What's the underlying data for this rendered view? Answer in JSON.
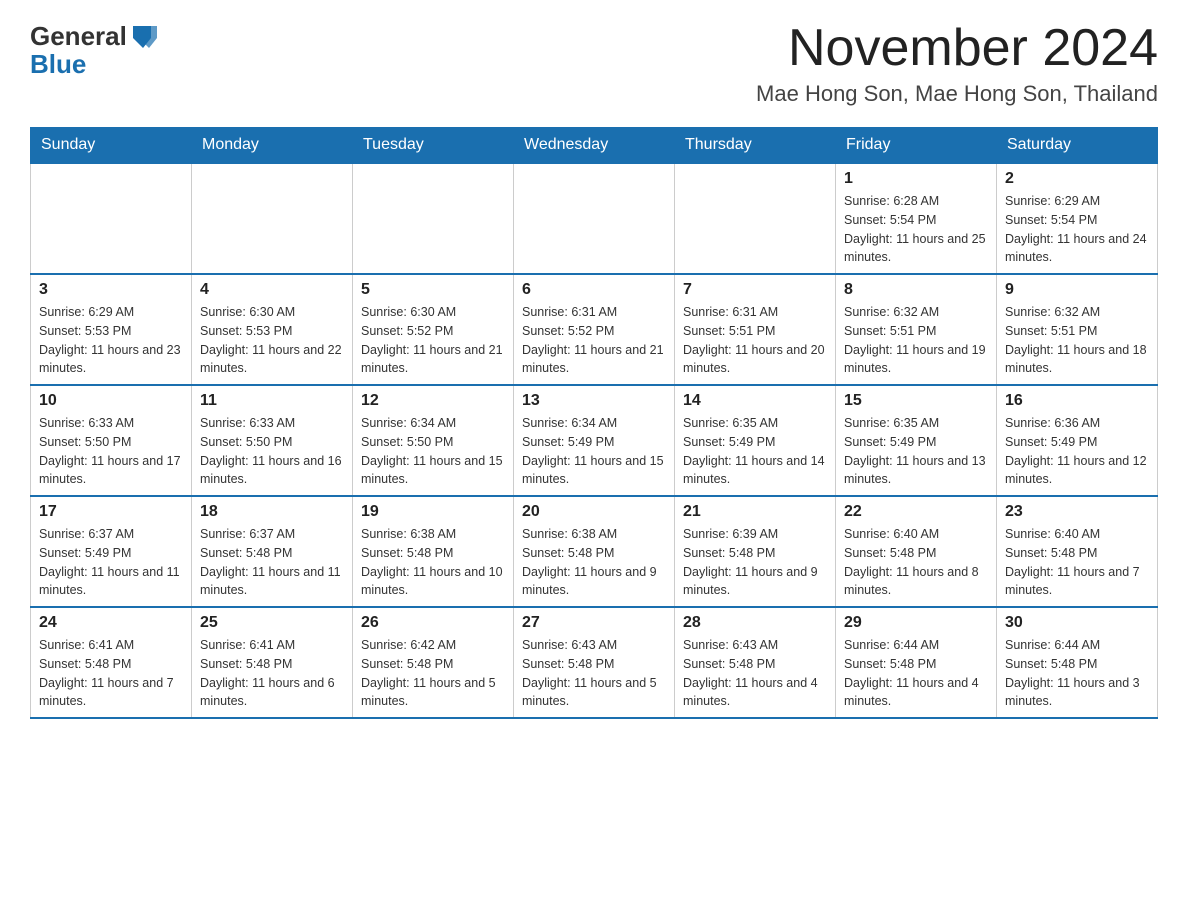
{
  "header": {
    "logo_general": "General",
    "logo_blue": "Blue",
    "month_title": "November 2024",
    "location": "Mae Hong Son, Mae Hong Son, Thailand"
  },
  "weekdays": [
    "Sunday",
    "Monday",
    "Tuesday",
    "Wednesday",
    "Thursday",
    "Friday",
    "Saturday"
  ],
  "weeks": [
    [
      {
        "day": "",
        "sunrise": "",
        "sunset": "",
        "daylight": ""
      },
      {
        "day": "",
        "sunrise": "",
        "sunset": "",
        "daylight": ""
      },
      {
        "day": "",
        "sunrise": "",
        "sunset": "",
        "daylight": ""
      },
      {
        "day": "",
        "sunrise": "",
        "sunset": "",
        "daylight": ""
      },
      {
        "day": "",
        "sunrise": "",
        "sunset": "",
        "daylight": ""
      },
      {
        "day": "1",
        "sunrise": "Sunrise: 6:28 AM",
        "sunset": "Sunset: 5:54 PM",
        "daylight": "Daylight: 11 hours and 25 minutes."
      },
      {
        "day": "2",
        "sunrise": "Sunrise: 6:29 AM",
        "sunset": "Sunset: 5:54 PM",
        "daylight": "Daylight: 11 hours and 24 minutes."
      }
    ],
    [
      {
        "day": "3",
        "sunrise": "Sunrise: 6:29 AM",
        "sunset": "Sunset: 5:53 PM",
        "daylight": "Daylight: 11 hours and 23 minutes."
      },
      {
        "day": "4",
        "sunrise": "Sunrise: 6:30 AM",
        "sunset": "Sunset: 5:53 PM",
        "daylight": "Daylight: 11 hours and 22 minutes."
      },
      {
        "day": "5",
        "sunrise": "Sunrise: 6:30 AM",
        "sunset": "Sunset: 5:52 PM",
        "daylight": "Daylight: 11 hours and 21 minutes."
      },
      {
        "day": "6",
        "sunrise": "Sunrise: 6:31 AM",
        "sunset": "Sunset: 5:52 PM",
        "daylight": "Daylight: 11 hours and 21 minutes."
      },
      {
        "day": "7",
        "sunrise": "Sunrise: 6:31 AM",
        "sunset": "Sunset: 5:51 PM",
        "daylight": "Daylight: 11 hours and 20 minutes."
      },
      {
        "day": "8",
        "sunrise": "Sunrise: 6:32 AM",
        "sunset": "Sunset: 5:51 PM",
        "daylight": "Daylight: 11 hours and 19 minutes."
      },
      {
        "day": "9",
        "sunrise": "Sunrise: 6:32 AM",
        "sunset": "Sunset: 5:51 PM",
        "daylight": "Daylight: 11 hours and 18 minutes."
      }
    ],
    [
      {
        "day": "10",
        "sunrise": "Sunrise: 6:33 AM",
        "sunset": "Sunset: 5:50 PM",
        "daylight": "Daylight: 11 hours and 17 minutes."
      },
      {
        "day": "11",
        "sunrise": "Sunrise: 6:33 AM",
        "sunset": "Sunset: 5:50 PM",
        "daylight": "Daylight: 11 hours and 16 minutes."
      },
      {
        "day": "12",
        "sunrise": "Sunrise: 6:34 AM",
        "sunset": "Sunset: 5:50 PM",
        "daylight": "Daylight: 11 hours and 15 minutes."
      },
      {
        "day": "13",
        "sunrise": "Sunrise: 6:34 AM",
        "sunset": "Sunset: 5:49 PM",
        "daylight": "Daylight: 11 hours and 15 minutes."
      },
      {
        "day": "14",
        "sunrise": "Sunrise: 6:35 AM",
        "sunset": "Sunset: 5:49 PM",
        "daylight": "Daylight: 11 hours and 14 minutes."
      },
      {
        "day": "15",
        "sunrise": "Sunrise: 6:35 AM",
        "sunset": "Sunset: 5:49 PM",
        "daylight": "Daylight: 11 hours and 13 minutes."
      },
      {
        "day": "16",
        "sunrise": "Sunrise: 6:36 AM",
        "sunset": "Sunset: 5:49 PM",
        "daylight": "Daylight: 11 hours and 12 minutes."
      }
    ],
    [
      {
        "day": "17",
        "sunrise": "Sunrise: 6:37 AM",
        "sunset": "Sunset: 5:49 PM",
        "daylight": "Daylight: 11 hours and 11 minutes."
      },
      {
        "day": "18",
        "sunrise": "Sunrise: 6:37 AM",
        "sunset": "Sunset: 5:48 PM",
        "daylight": "Daylight: 11 hours and 11 minutes."
      },
      {
        "day": "19",
        "sunrise": "Sunrise: 6:38 AM",
        "sunset": "Sunset: 5:48 PM",
        "daylight": "Daylight: 11 hours and 10 minutes."
      },
      {
        "day": "20",
        "sunrise": "Sunrise: 6:38 AM",
        "sunset": "Sunset: 5:48 PM",
        "daylight": "Daylight: 11 hours and 9 minutes."
      },
      {
        "day": "21",
        "sunrise": "Sunrise: 6:39 AM",
        "sunset": "Sunset: 5:48 PM",
        "daylight": "Daylight: 11 hours and 9 minutes."
      },
      {
        "day": "22",
        "sunrise": "Sunrise: 6:40 AM",
        "sunset": "Sunset: 5:48 PM",
        "daylight": "Daylight: 11 hours and 8 minutes."
      },
      {
        "day": "23",
        "sunrise": "Sunrise: 6:40 AM",
        "sunset": "Sunset: 5:48 PM",
        "daylight": "Daylight: 11 hours and 7 minutes."
      }
    ],
    [
      {
        "day": "24",
        "sunrise": "Sunrise: 6:41 AM",
        "sunset": "Sunset: 5:48 PM",
        "daylight": "Daylight: 11 hours and 7 minutes."
      },
      {
        "day": "25",
        "sunrise": "Sunrise: 6:41 AM",
        "sunset": "Sunset: 5:48 PM",
        "daylight": "Daylight: 11 hours and 6 minutes."
      },
      {
        "day": "26",
        "sunrise": "Sunrise: 6:42 AM",
        "sunset": "Sunset: 5:48 PM",
        "daylight": "Daylight: 11 hours and 5 minutes."
      },
      {
        "day": "27",
        "sunrise": "Sunrise: 6:43 AM",
        "sunset": "Sunset: 5:48 PM",
        "daylight": "Daylight: 11 hours and 5 minutes."
      },
      {
        "day": "28",
        "sunrise": "Sunrise: 6:43 AM",
        "sunset": "Sunset: 5:48 PM",
        "daylight": "Daylight: 11 hours and 4 minutes."
      },
      {
        "day": "29",
        "sunrise": "Sunrise: 6:44 AM",
        "sunset": "Sunset: 5:48 PM",
        "daylight": "Daylight: 11 hours and 4 minutes."
      },
      {
        "day": "30",
        "sunrise": "Sunrise: 6:44 AM",
        "sunset": "Sunset: 5:48 PM",
        "daylight": "Daylight: 11 hours and 3 minutes."
      }
    ]
  ]
}
